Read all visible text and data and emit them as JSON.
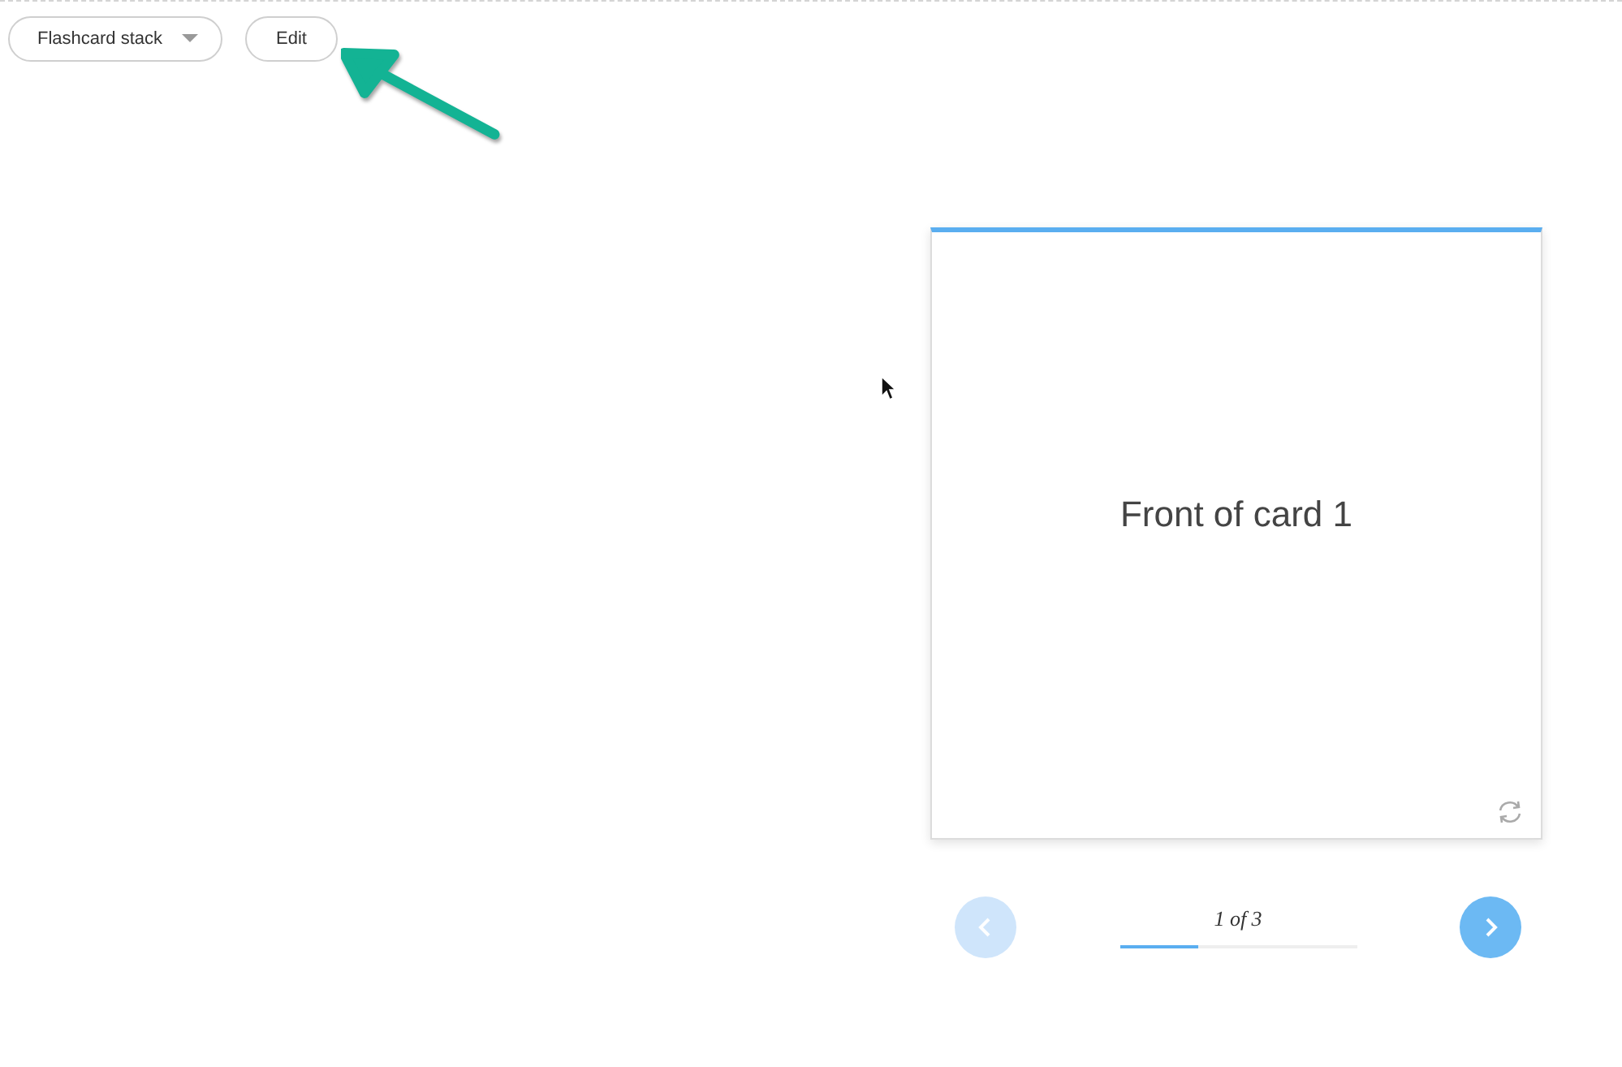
{
  "toolbar": {
    "stack_menu": {
      "label": "Flashcard stack"
    },
    "edit_button": {
      "label": "Edit"
    }
  },
  "card": {
    "front_text": "Front of card 1"
  },
  "navigation": {
    "previous": {
      "disabled": true
    },
    "next": {
      "disabled": false
    },
    "counter": "1 of 3",
    "progress": {
      "level": 0.33
    }
  }
}
